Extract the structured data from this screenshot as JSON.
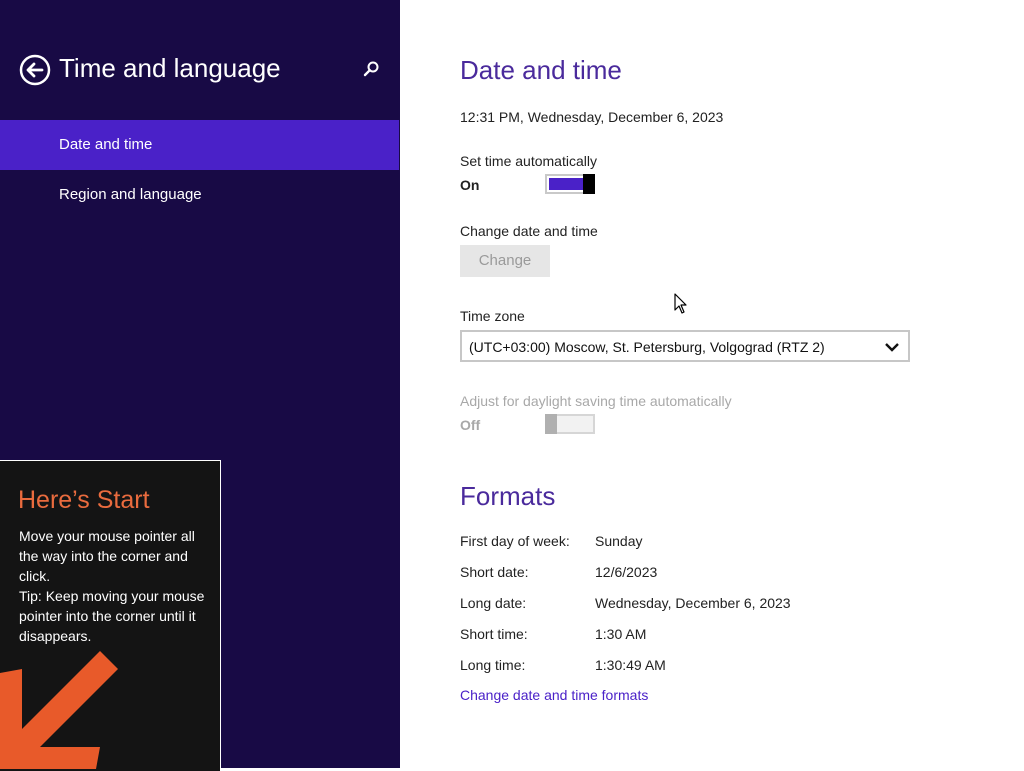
{
  "sidebar": {
    "title": "Time and language",
    "items": [
      {
        "label": "Date and time",
        "selected": true
      },
      {
        "label": "Region and language",
        "selected": false
      }
    ]
  },
  "tip": {
    "title": "Here’s Start",
    "line1": "Move your mouse pointer all the way into the corner and click.",
    "line2": "Tip: Keep moving your mouse pointer into the corner until it disappears."
  },
  "main": {
    "heading": "Date and time",
    "current_datetime": "12:31 PM, Wednesday, December 6, 2023",
    "set_time_auto": {
      "label": "Set time automatically",
      "state": "On"
    },
    "change": {
      "label": "Change date and time",
      "button": "Change"
    },
    "timezone": {
      "label": "Time zone",
      "value": "(UTC+03:00) Moscow, St. Petersburg, Volgograd (RTZ 2)"
    },
    "dst": {
      "label": "Adjust for daylight saving time automatically",
      "state": "Off"
    },
    "formats": {
      "heading": "Formats",
      "rows": [
        {
          "label": "First day of week:",
          "value": "Sunday"
        },
        {
          "label": "Short date:",
          "value": "12/6/2023"
        },
        {
          "label": "Long date:",
          "value": "Wednesday, December 6, 2023"
        },
        {
          "label": "Short time:",
          "value": "1:30 AM"
        },
        {
          "label": "Long time:",
          "value": "1:30:49 AM"
        }
      ],
      "link": "Change date and time formats"
    }
  },
  "colors": {
    "accent": "#4a21c8",
    "sidebar_bg": "#180a45",
    "tip_title": "#e96b3e"
  }
}
